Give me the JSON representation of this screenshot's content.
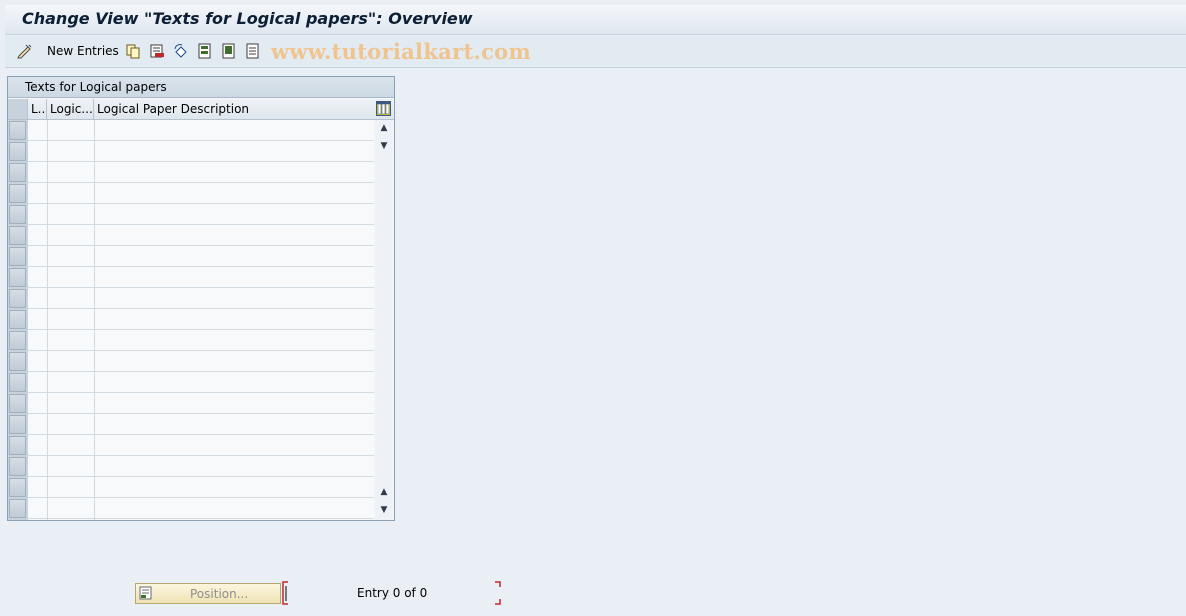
{
  "window": {
    "title": "Change View \"Texts for Logical papers\": Overview"
  },
  "toolbar": {
    "new_entries_label": "New Entries",
    "watermark": "www.tutorialkart.com"
  },
  "table": {
    "title": "Texts for Logical papers",
    "columns": [
      "L...",
      "Logic...",
      "Logical Paper Description"
    ],
    "row_count": 19
  },
  "footer": {
    "position_label": "Position...",
    "entry_text": "Entry 0 of 0"
  },
  "colors": {
    "accent": "#0d1f35",
    "background": "#e9eff5",
    "position_button": "#efe3b4"
  }
}
